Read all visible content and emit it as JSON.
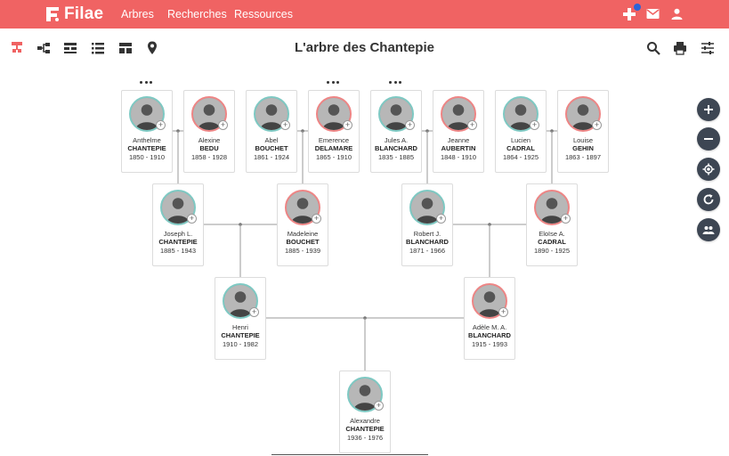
{
  "header": {
    "brand": "Filae",
    "nav": [
      "Arbres",
      "Recherches",
      "Ressources"
    ]
  },
  "toolbar": {
    "title": "L'arbre des Chantepie",
    "icons": [
      "tree-view-icon",
      "descendants-view-icon",
      "compact-view-icon",
      "list-view-icon",
      "layout-view-icon",
      "map-pin-icon",
      "search-icon",
      "print-icon",
      "settings-sliders-icon"
    ]
  },
  "colors": {
    "brand": "#f06363",
    "male": "#7ec9c3",
    "female": "#ee8585",
    "control": "#3d4653",
    "notification": "#2c63d6"
  },
  "side_controls": [
    "zoom-in-icon",
    "zoom-out-icon",
    "center-icon",
    "refresh-icon",
    "people-icon"
  ],
  "people": [
    {
      "first": "Anthelme",
      "last": "CHANTEPIE",
      "dates": "1850 - 1910",
      "sex": "m"
    },
    {
      "first": "Alexine",
      "last": "BEDU",
      "dates": "1858 - 1928",
      "sex": "f"
    },
    {
      "first": "Abel",
      "last": "BOUCHET",
      "dates": "1861 - 1924",
      "sex": "m"
    },
    {
      "first": "Emerence",
      "last": "DELAMARE",
      "dates": "1865 - 1910",
      "sex": "f"
    },
    {
      "first": "Jules A.",
      "last": "BLANCHARD",
      "dates": "1835 - 1885",
      "sex": "m"
    },
    {
      "first": "Jeanne",
      "last": "AUBERTIN",
      "dates": "1848 - 1910",
      "sex": "f"
    },
    {
      "first": "Lucien",
      "last": "CADRAL",
      "dates": "1864 - 1925",
      "sex": "m"
    },
    {
      "first": "Louise",
      "last": "GEHIN",
      "dates": "1863 - 1897",
      "sex": "f"
    },
    {
      "first": "Joseph L.",
      "last": "CHANTEPIE",
      "dates": "1885 - 1943",
      "sex": "m"
    },
    {
      "first": "Madeleine",
      "last": "BOUCHET",
      "dates": "1885 - 1939",
      "sex": "f"
    },
    {
      "first": "Robert J.",
      "last": "BLANCHARD",
      "dates": "1871 - 1966",
      "sex": "m"
    },
    {
      "first": "Eloïse A.",
      "last": "CADRAL",
      "dates": "1890 - 1925",
      "sex": "f"
    },
    {
      "first": "Henri",
      "last": "CHANTEPIE",
      "dates": "1910 - 1982",
      "sex": "m"
    },
    {
      "first": "Adèle M. A.",
      "last": "BLANCHARD",
      "dates": "1915 - 1993",
      "sex": "f"
    },
    {
      "first": "Alexandre",
      "last": "CHANTEPIE",
      "dates": "1936 - 1976",
      "sex": "m"
    }
  ]
}
